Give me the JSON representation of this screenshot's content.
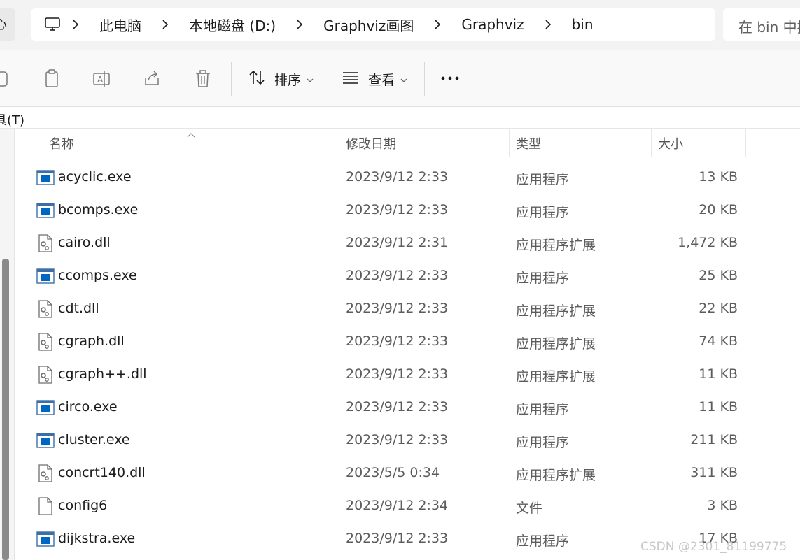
{
  "address_bar": {
    "left_button_glyph": "心",
    "breadcrumb": [
      {
        "label": "此电脑"
      },
      {
        "label": "本地磁盘 (D:)"
      },
      {
        "label": "Graphviz画图"
      },
      {
        "label": "Graphviz"
      },
      {
        "label": "bin"
      }
    ],
    "search_placeholder": "在 bin 中搜"
  },
  "command_bar": {
    "sort_label": "排序",
    "view_label": "查看",
    "icons": [
      "copy-icon",
      "paste-icon",
      "rename-icon",
      "share-icon",
      "delete-icon",
      "sort-icon",
      "view-icon",
      "more-icon"
    ]
  },
  "menu": {
    "tools_label": "具(T)"
  },
  "columns": {
    "name": "名称",
    "date": "修改日期",
    "type": "类型",
    "size": "大小"
  },
  "files": [
    {
      "name": "acyclic.exe",
      "date": "2023/9/12 2:33",
      "type": "应用程序",
      "size": "13 KB",
      "icon": "exe"
    },
    {
      "name": "bcomps.exe",
      "date": "2023/9/12 2:33",
      "type": "应用程序",
      "size": "20 KB",
      "icon": "exe"
    },
    {
      "name": "cairo.dll",
      "date": "2023/9/12 2:31",
      "type": "应用程序扩展",
      "size": "1,472 KB",
      "icon": "dll"
    },
    {
      "name": "ccomps.exe",
      "date": "2023/9/12 2:33",
      "type": "应用程序",
      "size": "25 KB",
      "icon": "exe"
    },
    {
      "name": "cdt.dll",
      "date": "2023/9/12 2:33",
      "type": "应用程序扩展",
      "size": "22 KB",
      "icon": "dll"
    },
    {
      "name": "cgraph.dll",
      "date": "2023/9/12 2:33",
      "type": "应用程序扩展",
      "size": "74 KB",
      "icon": "dll"
    },
    {
      "name": "cgraph++.dll",
      "date": "2023/9/12 2:33",
      "type": "应用程序扩展",
      "size": "11 KB",
      "icon": "dll"
    },
    {
      "name": "circo.exe",
      "date": "2023/9/12 2:33",
      "type": "应用程序",
      "size": "11 KB",
      "icon": "exe"
    },
    {
      "name": "cluster.exe",
      "date": "2023/9/12 2:33",
      "type": "应用程序",
      "size": "211 KB",
      "icon": "exe"
    },
    {
      "name": "concrt140.dll",
      "date": "2023/5/5 0:34",
      "type": "应用程序扩展",
      "size": "311 KB",
      "icon": "dll"
    },
    {
      "name": "config6",
      "date": "2023/9/12 2:34",
      "type": "文件",
      "size": "3 KB",
      "icon": "file"
    },
    {
      "name": "dijkstra.exe",
      "date": "2023/9/12 2:33",
      "type": "应用程序",
      "size": "17 KB",
      "icon": "exe"
    }
  ],
  "watermark": "CSDN @2301_81199775",
  "colors": {
    "accent_blue": "#0067c0",
    "icon_gray": "#6e6e6e",
    "exe_frame": "#3c6ea8"
  }
}
